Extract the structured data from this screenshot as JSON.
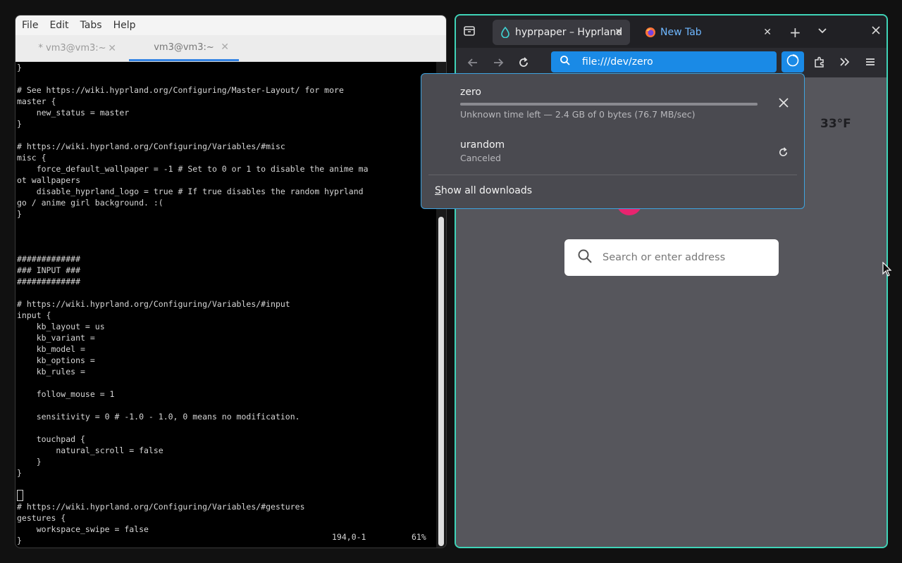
{
  "terminal": {
    "menu": [
      "File",
      "Edit",
      "Tabs",
      "Help"
    ],
    "tabs": [
      {
        "label": "* vm3@vm3:~"
      },
      {
        "label": "vm3@vm3:~"
      }
    ],
    "lines": [
      "}",
      "",
      "# See https://wiki.hyprland.org/Configuring/Master-Layout/ for more",
      "master {",
      "    new_status = master",
      "}",
      "",
      "# https://wiki.hyprland.org/Configuring/Variables/#misc",
      "misc {",
      "    force_default_wallpaper = -1 # Set to 0 or 1 to disable the anime ma",
      "ot wallpapers",
      "    disable_hyprland_logo = true # If true disables the random hyprland",
      "go / anime girl background. :(",
      "}",
      "",
      "",
      "",
      "#############",
      "### INPUT ###",
      "#############",
      "",
      "# https://wiki.hyprland.org/Configuring/Variables/#input",
      "input {",
      "    kb_layout = us",
      "    kb_variant =",
      "    kb_model =",
      "    kb_options =",
      "    kb_rules =",
      "",
      "    follow_mouse = 1",
      "",
      "    sensitivity = 0 # -1.0 - 1.0, 0 means no modification.",
      "",
      "    touchpad {",
      "        natural_scroll = false",
      "    }",
      "}",
      "",
      "# https://wiki.hyprland.org/Configuring/Variables/#gestures",
      "gestures {",
      "    workspace_swipe = false",
      "}"
    ],
    "status_position": "194,0-1",
    "status_percent": "61%"
  },
  "browser": {
    "tabs": [
      {
        "label": "hyprpaper – Hyprland"
      },
      {
        "label": "New Tab"
      }
    ],
    "url": "file:///dev/zero",
    "weather": "33°F",
    "search_placeholder": "Search or enter address",
    "accent": "#1a8ae6",
    "window_border": "#3fd4b8"
  },
  "downloads": {
    "items": [
      {
        "name": "zero",
        "status": "Unknown time left — 2.4 GB of 0 bytes (76.7 MB/sec)",
        "action": "close-icon"
      },
      {
        "name": "urandom",
        "status": "Canceled",
        "action": "retry-icon"
      }
    ],
    "show_all": "Show all downloads",
    "show_all_first": "S",
    "show_all_rest": "how all downloads"
  }
}
